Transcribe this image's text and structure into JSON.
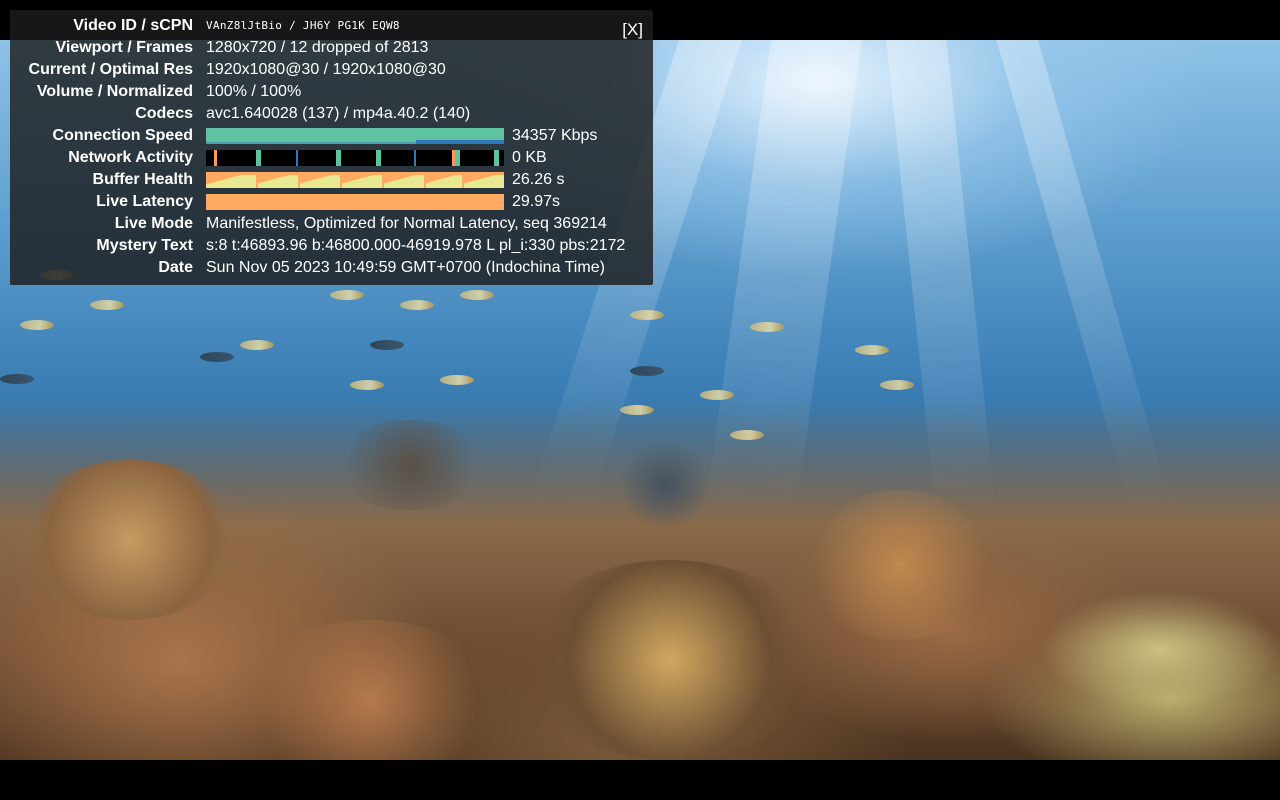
{
  "stats": {
    "close_label": "[X]",
    "rows": [
      {
        "label": "Video ID / sCPN",
        "value": "VAnZ8lJtBio / JH6Y PG1K EQW8"
      },
      {
        "label": "Viewport / Frames",
        "value": "1280x720 / 12 dropped of 2813"
      },
      {
        "label": "Current / Optimal Res",
        "value": "1920x1080@30 / 1920x1080@30"
      },
      {
        "label": "Volume / Normalized",
        "value": "100% / 100%"
      },
      {
        "label": "Codecs",
        "value": "avc1.640028 (137) / mp4a.40.2 (140)"
      },
      {
        "label": "Connection Speed",
        "value": "34357 Kbps"
      },
      {
        "label": "Network Activity",
        "value": "0 KB"
      },
      {
        "label": "Buffer Health",
        "value": "26.26 s"
      },
      {
        "label": "Live Latency",
        "value": "29.97s"
      },
      {
        "label": "Live Mode",
        "value": "Manifestless, Optimized for Normal Latency, seq 369214"
      },
      {
        "label": "Mystery Text",
        "value": "s:8 t:46893.96 b:46800.000-46919.978 L pl_i:330 pbs:2172"
      },
      {
        "label": "Date",
        "value": "Sun Nov 05 2023 10:49:59 GMT+0700 (Indochina Time)"
      }
    ]
  },
  "colors": {
    "speed_graph": "#5fc2a0",
    "speed_line": "#2e7ab8",
    "buffer_graph": "#e8e890",
    "latency_graph": "#ffaa60",
    "panel_bg": "#1c1c1c"
  }
}
